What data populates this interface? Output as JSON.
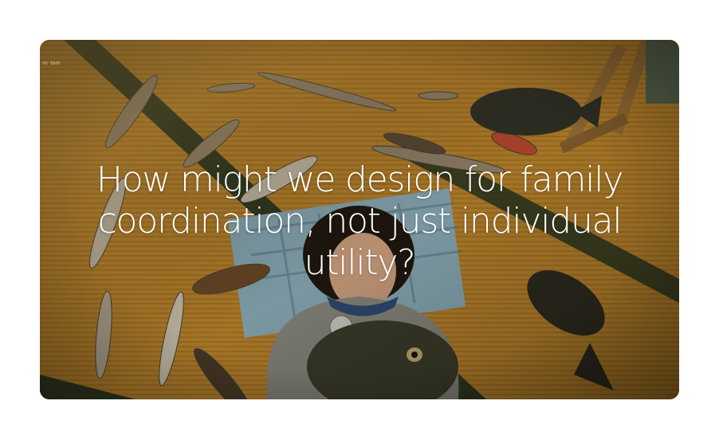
{
  "card": {
    "headline": "How might we design for family coordination, not just individual utility?",
    "image_alt": "Overhead photo of a person lying on tatami mats surrounded by dried fish",
    "watermark": "·m ·tom"
  },
  "colors": {
    "page_background": "#ffffff",
    "headline_text": "#ffffff",
    "tatami": "#c48d34",
    "tatami_border": "#2f3a22",
    "sweater": "#8e8f88"
  }
}
